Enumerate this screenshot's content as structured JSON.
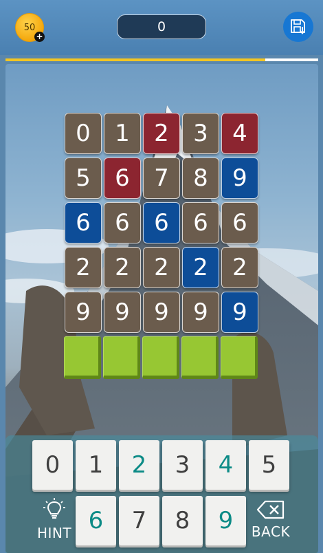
{
  "header": {
    "coins": "50",
    "coin_add": "+",
    "score": "0",
    "save_icon": "save-download-icon"
  },
  "progress": {
    "fraction": 0.83,
    "fill_color": "#f2c523",
    "track_color": "#ffffff"
  },
  "colors": {
    "brown": "#6b5c4d",
    "red": "#8c2530",
    "blue": "#0d4d98",
    "teal_digit": "#0c8b86",
    "gray_digit": "#3f3f3f",
    "answer_green": "#97c733"
  },
  "board": {
    "rows": [
      [
        {
          "v": "0",
          "c": "brown"
        },
        {
          "v": "1",
          "c": "brown"
        },
        {
          "v": "2",
          "c": "red"
        },
        {
          "v": "3",
          "c": "brown"
        },
        {
          "v": "4",
          "c": "red"
        }
      ],
      [
        {
          "v": "5",
          "c": "brown"
        },
        {
          "v": "6",
          "c": "red"
        },
        {
          "v": "7",
          "c": "brown"
        },
        {
          "v": "8",
          "c": "brown"
        },
        {
          "v": "9",
          "c": "blue"
        }
      ],
      [
        {
          "v": "6",
          "c": "blue"
        },
        {
          "v": "6",
          "c": "brown"
        },
        {
          "v": "6",
          "c": "blue"
        },
        {
          "v": "6",
          "c": "brown"
        },
        {
          "v": "6",
          "c": "brown"
        }
      ],
      [
        {
          "v": "2",
          "c": "brown"
        },
        {
          "v": "2",
          "c": "brown"
        },
        {
          "v": "2",
          "c": "brown"
        },
        {
          "v": "2",
          "c": "blue"
        },
        {
          "v": "2",
          "c": "brown"
        }
      ],
      [
        {
          "v": "9",
          "c": "brown"
        },
        {
          "v": "9",
          "c": "brown"
        },
        {
          "v": "9",
          "c": "brown"
        },
        {
          "v": "9",
          "c": "brown"
        },
        {
          "v": "9",
          "c": "blue"
        }
      ]
    ],
    "answer_slots": [
      "",
      "",
      "",
      "",
      ""
    ]
  },
  "keypad": {
    "row1": [
      {
        "label": "0",
        "tone": "gray"
      },
      {
        "label": "1",
        "tone": "gray"
      },
      {
        "label": "2",
        "tone": "teal"
      },
      {
        "label": "3",
        "tone": "gray"
      },
      {
        "label": "4",
        "tone": "teal"
      },
      {
        "label": "5",
        "tone": "gray"
      }
    ],
    "row2": [
      {
        "label": "6",
        "tone": "teal"
      },
      {
        "label": "7",
        "tone": "gray"
      },
      {
        "label": "8",
        "tone": "gray"
      },
      {
        "label": "9",
        "tone": "teal"
      }
    ],
    "hint_label": "HINT",
    "back_label": "BACK",
    "hint_icon": "lightbulb-icon",
    "back_icon": "backspace-icon"
  }
}
